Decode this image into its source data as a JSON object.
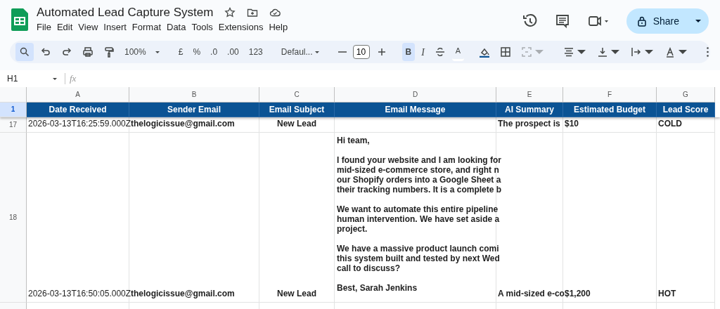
{
  "document": {
    "title": "Automated Lead Capture System"
  },
  "menu": [
    "File",
    "Edit",
    "View",
    "Insert",
    "Format",
    "Data",
    "Tools",
    "Extensions",
    "Help"
  ],
  "share": {
    "label": "Share"
  },
  "toolbar": {
    "zoom": "100%",
    "currency": "£",
    "percent": "%",
    "decrease_decimals": ".0",
    "increase_decimals": ".00",
    "number_format": "123",
    "font": "Defaul...",
    "font_size": "10",
    "bold": {
      "label": "B",
      "selected": true
    },
    "italic": {
      "label": "I",
      "selected": false
    },
    "text_color": {
      "label": "A"
    },
    "merge": {
      "disabled": true
    }
  },
  "formula_bar": {
    "cell": "H1",
    "fx": "fx"
  },
  "columns": [
    "A",
    "B",
    "C",
    "D",
    "E",
    "F",
    "G"
  ],
  "header_row": {
    "number": "1",
    "selected": true,
    "cells": [
      "Date Received",
      "Sender Email",
      "Email Subject",
      "Email Message",
      "AI Summary",
      "Estimated Budget",
      "Lead Score"
    ]
  },
  "rows": [
    {
      "number": "17",
      "date": "2026-03-13T16:25:59.000Z",
      "sender": "thelogicissue@gmail.com",
      "subject": "New Lead",
      "summary": "The prospect is",
      "budget": "$10",
      "score": "COLD"
    },
    {
      "number": "18",
      "date": "2026-03-13T16:50:05.000Z",
      "sender": "thelogicissue@gmail.com",
      "subject": "New Lead",
      "message": [
        [
          "Hi team,"
        ],
        [
          "I found your website and I am looking for",
          "mid-sized e-commerce store, and right n",
          "our Shopify orders into a Google Sheet a",
          "their tracking numbers. It is a complete b"
        ],
        [
          "We want to automate this entire pipeline",
          "human intervention. We have set aside a",
          "project."
        ],
        [
          "We have a massive product launch comi",
          "this system built and tested by next Wed",
          "call to discuss?"
        ],
        [
          "Best, Sarah Jenkins"
        ]
      ],
      "summary": "A mid-sized e-co",
      "budget": "$1,200",
      "score": "HOT"
    }
  ]
}
